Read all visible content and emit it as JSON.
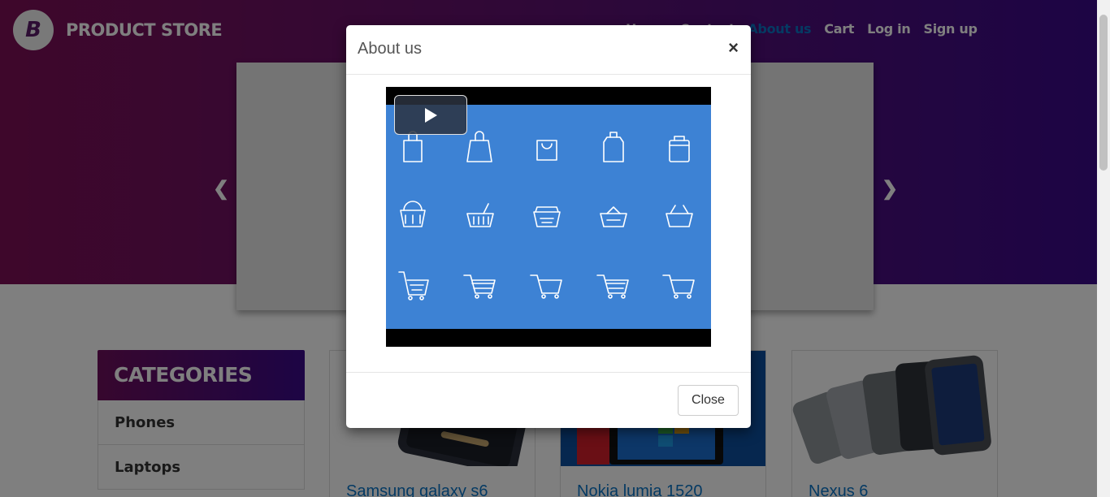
{
  "brand": {
    "logo_letter": "B",
    "name": "PRODUCT STORE"
  },
  "nav": {
    "items": [
      {
        "label": "Home"
      },
      {
        "label": "Contact"
      },
      {
        "label": "About us"
      },
      {
        "label": "Cart"
      },
      {
        "label": "Log in"
      },
      {
        "label": "Sign up"
      }
    ]
  },
  "carousel": {
    "prev_icon": "chevron-left-icon",
    "next_icon": "chevron-right-icon"
  },
  "categories": {
    "title": "CATEGORIES",
    "items": [
      {
        "label": "Phones"
      },
      {
        "label": "Laptops"
      }
    ]
  },
  "products": [
    {
      "title": "Samsung galaxy s6"
    },
    {
      "title": "Nokia lumia 1520"
    },
    {
      "title": "Nexus 6"
    }
  ],
  "modal": {
    "title": "About us",
    "close_symbol": "×",
    "video_poster": "shopping-bags-baskets-carts-icons",
    "play_icon": "play-icon",
    "footer_close_label": "Close"
  },
  "colors": {
    "hero_start": "#7d0f56",
    "hero_end": "#3a0a8a",
    "link_blue": "#0a74c7",
    "video_bg": "#3d82d4"
  }
}
